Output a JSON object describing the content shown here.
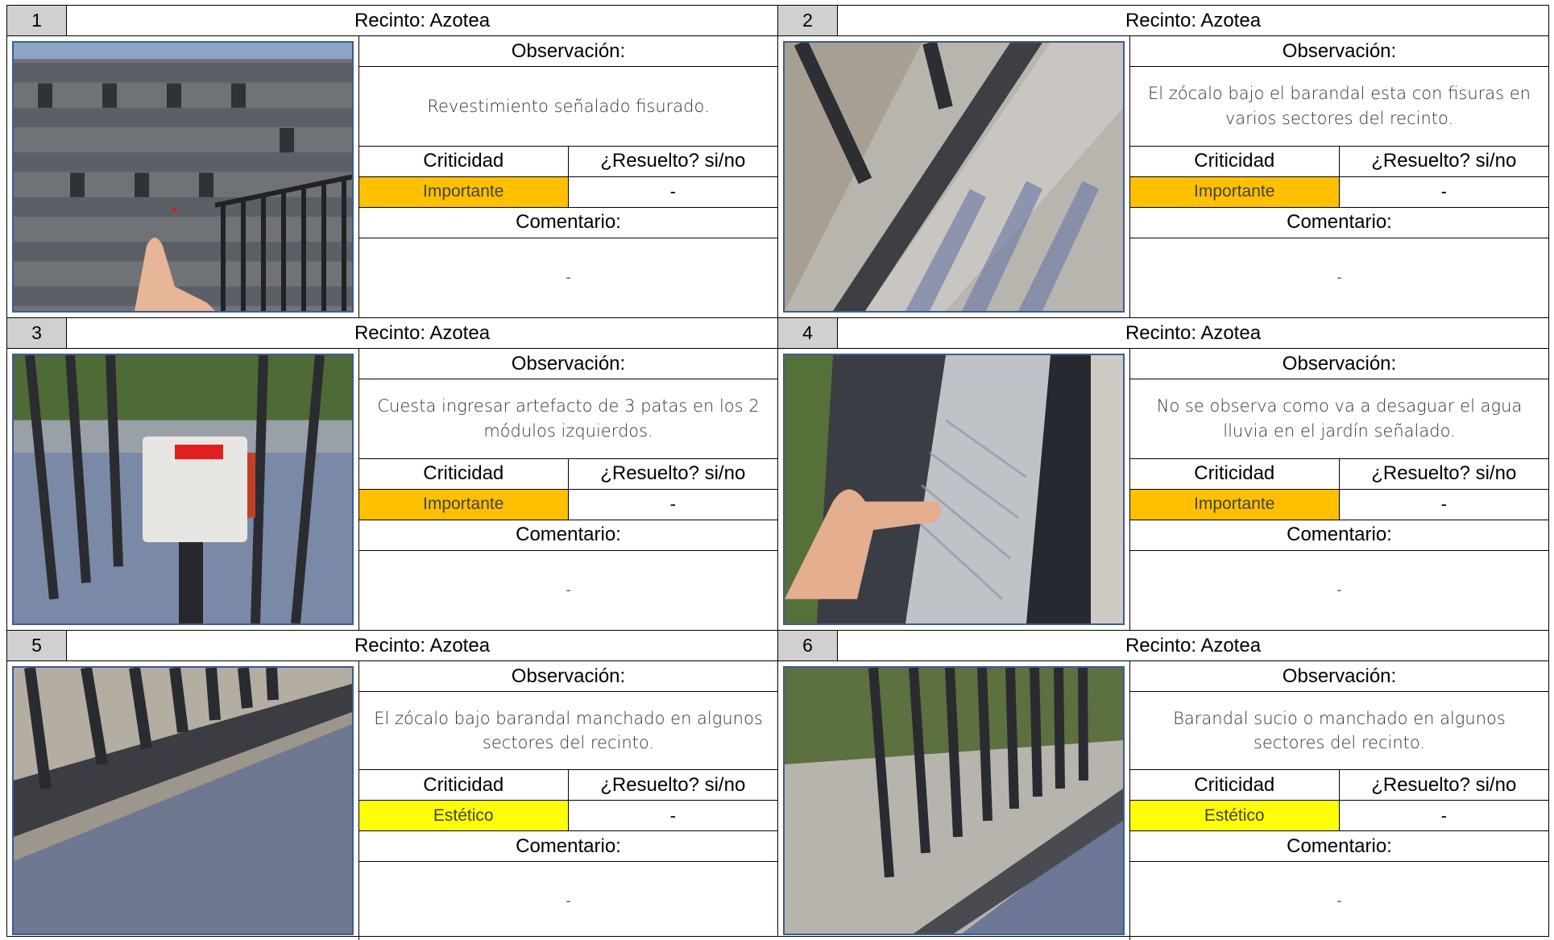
{
  "labels": {
    "observacion": "Observación:",
    "criticidad": "Criticidad",
    "resuelto": "¿Resuelto? si/no",
    "comentario": "Comentario:"
  },
  "cards": [
    {
      "num": "1",
      "recinto": "Recinto: Azotea",
      "observacion": "Revestimiento señalado fisurado.",
      "criticidad": "Importante",
      "resuelto": "-",
      "comentario": "-"
    },
    {
      "num": "2",
      "recinto": "Recinto: Azotea",
      "observacion": "El zócalo bajo el barandal esta con fisuras en varios sectores del recinto.",
      "criticidad": "Importante",
      "resuelto": "-",
      "comentario": "-"
    },
    {
      "num": "3",
      "recinto": "Recinto: Azotea",
      "observacion": "Cuesta ingresar artefacto de 3 patas en los 2 módulos izquierdos.",
      "criticidad": "Importante",
      "resuelto": "-",
      "comentario": "-"
    },
    {
      "num": "4",
      "recinto": "Recinto: Azotea",
      "observacion": "No se observa como va a desaguar el agua lluvia en el jardín señalado.",
      "criticidad": "Importante",
      "resuelto": "-",
      "comentario": "-"
    },
    {
      "num": "5",
      "recinto": "Recinto: Azotea",
      "observacion": "El zócalo bajo barandal manchado en algunos sectores del recinto.",
      "criticidad": "Estético",
      "resuelto": "-",
      "comentario": "-"
    },
    {
      "num": "6",
      "recinto": "Recinto: Azotea",
      "observacion": "Barandal sucio o manchado en algunos sectores del recinto.",
      "criticidad": "Estético",
      "resuelto": "-",
      "comentario": "-"
    }
  ],
  "colors": {
    "importante": "#ffc000",
    "estetico": "#ffff00",
    "header_num_bg": "#d0d0d0",
    "photo_border": "#3b5b95"
  }
}
